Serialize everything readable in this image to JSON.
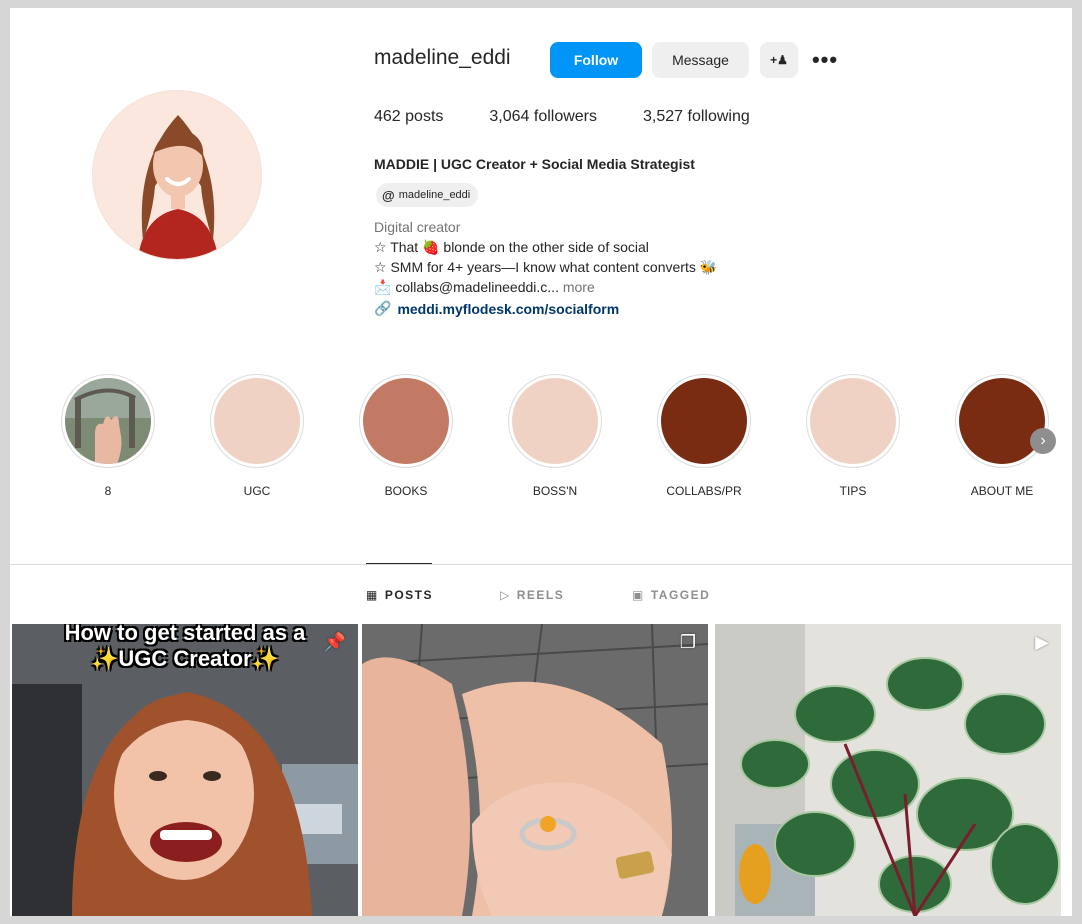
{
  "profile": {
    "username": "madeline_eddi",
    "follow_label": "Follow",
    "message_label": "Message",
    "suggest_icon": "add-person-icon",
    "more_icon": "more-options-icon",
    "more_glyph": "•••"
  },
  "stats": {
    "posts": "462 posts",
    "followers": "3,064 followers",
    "following": "3,527 following"
  },
  "bio": {
    "name": "MADDIE | UGC Creator + Social Media Strategist",
    "threads_handle": "madeline_eddi",
    "category": "Digital creator",
    "line1": "☆ That 🍓 blonde on the other side of social",
    "line2": "☆ SMM for 4+ years—I know what content converts 🐝",
    "line3": "📩 collabs@madelineeddi.c...",
    "more_label": "more",
    "link": "meddi.myflodesk.com/socialform"
  },
  "highlights": [
    {
      "label": "8",
      "color": "#6f7f63"
    },
    {
      "label": "UGC",
      "color": "#f0d2c4"
    },
    {
      "label": "BOOKS",
      "color": "#c27a64"
    },
    {
      "label": "BOSS'N",
      "color": "#f0d2c4"
    },
    {
      "label": "COLLABS/PR",
      "color": "#7a2c12"
    },
    {
      "label": "TIPS",
      "color": "#f0d2c4"
    },
    {
      "label": "ABOUT ME",
      "color": "#7a2c12"
    }
  ],
  "tabs": {
    "posts": "POSTS",
    "reels": "REELS",
    "tagged": "TAGGED"
  },
  "posts": [
    {
      "caption_line1": "How to get started as a",
      "caption_line2": "✨UGC Creator✨",
      "badge_icon": "pin-icon"
    },
    {
      "badge_icon": "carousel-icon"
    },
    {
      "badge_icon": "reel-icon"
    }
  ],
  "colors": {
    "accent": "#0095f6",
    "link": "#00376b"
  }
}
